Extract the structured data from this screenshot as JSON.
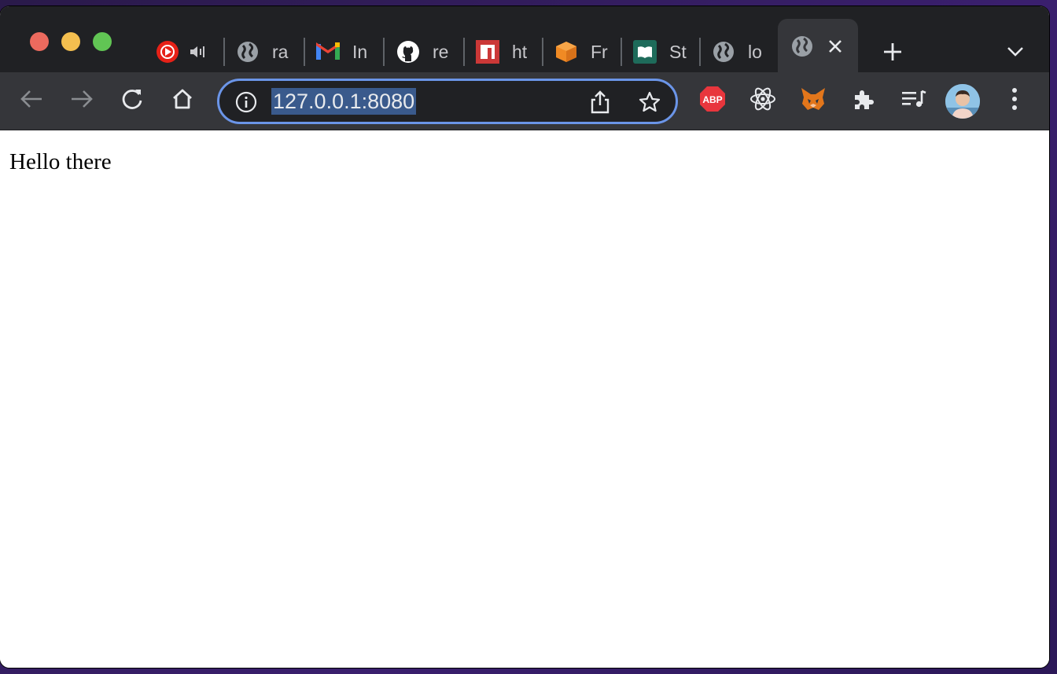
{
  "tabs": [
    {
      "label": "",
      "icon": "youtube-music-icon",
      "has_audio": true
    },
    {
      "label": "ra",
      "icon": "globe-icon"
    },
    {
      "label": "In",
      "icon": "gmail-icon"
    },
    {
      "label": "re",
      "icon": "github-icon"
    },
    {
      "label": "ht",
      "icon": "npm-icon"
    },
    {
      "label": "Fr",
      "icon": "box-icon"
    },
    {
      "label": "St",
      "icon": "book-icon"
    },
    {
      "label": "lo",
      "icon": "globe-icon"
    },
    {
      "label": "",
      "icon": "globe-icon",
      "active": true
    }
  ],
  "omnibox": {
    "url": "127.0.0.1:8080"
  },
  "extensions": [
    "abp-icon",
    "react-icon",
    "metamask-icon",
    "puzzle-icon",
    "media-queue-icon"
  ],
  "page": {
    "text": "Hello there"
  },
  "extensions_labels": {
    "abp": "ABP"
  }
}
